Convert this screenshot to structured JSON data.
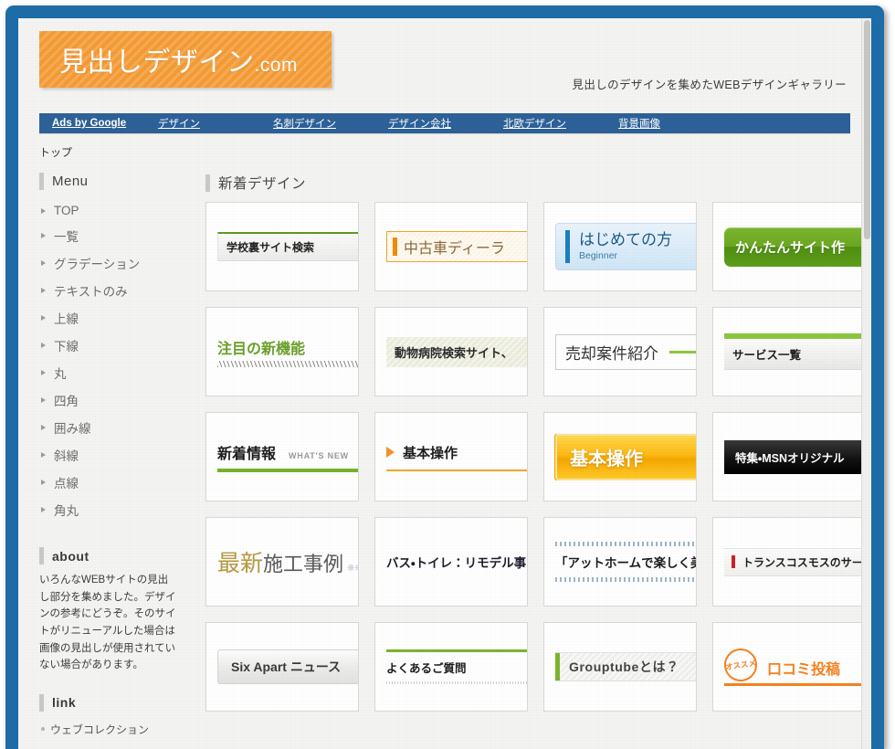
{
  "site": {
    "logo_main": "見出しデザイン",
    "logo_tld": ".com",
    "tagline": "見出しのデザインを集めたWEBデザインギャラリー"
  },
  "ads": {
    "brand": "Ads by Google",
    "links": [
      "デザイン",
      "名刺デザイン",
      "デザイン会社",
      "北欧デザイン",
      "背景画像"
    ]
  },
  "breadcrumb": "トップ",
  "sidebar": {
    "menu_heading": "Menu",
    "menu_items": [
      "TOP",
      "一覧",
      "グラデーション",
      "テキストのみ",
      "上線",
      "下線",
      "丸",
      "四角",
      "囲み線",
      "斜線",
      "点線",
      "角丸"
    ],
    "about_heading": "about",
    "about_text": "いろんなWEBサイトの見出し部分を集めました。デザインの参考にどうぞ。そのサイトがリニューアルした場合は画像の見出しが使用されていない場合があります。",
    "link_heading": "link",
    "link_items": [
      "ウェブコレクション"
    ]
  },
  "content": {
    "heading": "新着デザイン",
    "thumbs": [
      {
        "style": "greenbar-band",
        "text": "学校裏サイト検索"
      },
      {
        "style": "orangebox",
        "text": "中古車ディーラ"
      },
      {
        "style": "bluepanel",
        "text": "はじめての方",
        "sub": "Beginner"
      },
      {
        "style": "greenbtn",
        "text": "かんたんサイト作"
      },
      {
        "style": "greentext",
        "text": "注目の新機能"
      },
      {
        "style": "olivebox",
        "text": "動物病院検索サイト、"
      },
      {
        "style": "boxrule",
        "text": "売却案件紹介"
      },
      {
        "style": "greenthick",
        "text": "サービス一覧"
      },
      {
        "style": "whatsnew",
        "text": "新着情報",
        "sub": "WHAT'S NEW"
      },
      {
        "style": "tri",
        "text": "基本操作"
      },
      {
        "style": "yellowbtn",
        "text": "基本操作"
      },
      {
        "style": "blackbar",
        "text": "特集・MSNオリジナル"
      },
      {
        "style": "gold",
        "text": "最新",
        "sub": "施工事例",
        "dots": "❋❋"
      },
      {
        "style": "plainbold",
        "text": "バス・トイレ：リモデル事"
      },
      {
        "style": "dotrule",
        "text": "「アットホームで楽しく美"
      },
      {
        "style": "redtick",
        "text": "トランスコスモスのサービ"
      },
      {
        "style": "greytab",
        "text": "Six Apart ニュース"
      },
      {
        "style": "greenfaq",
        "text": "よくあるご質問"
      },
      {
        "style": "greenleft",
        "text": "Grouptubeとは？"
      },
      {
        "style": "badge",
        "text": "口コミ投稿",
        "sub": "オススメ"
      }
    ]
  },
  "colors": {
    "frame_blue": "#1d6ca8",
    "logo_orange": "#f59b34",
    "ads_blue": "#2d6198",
    "accent_green": "#8cc63f",
    "accent_yellow": "#fdb913"
  }
}
